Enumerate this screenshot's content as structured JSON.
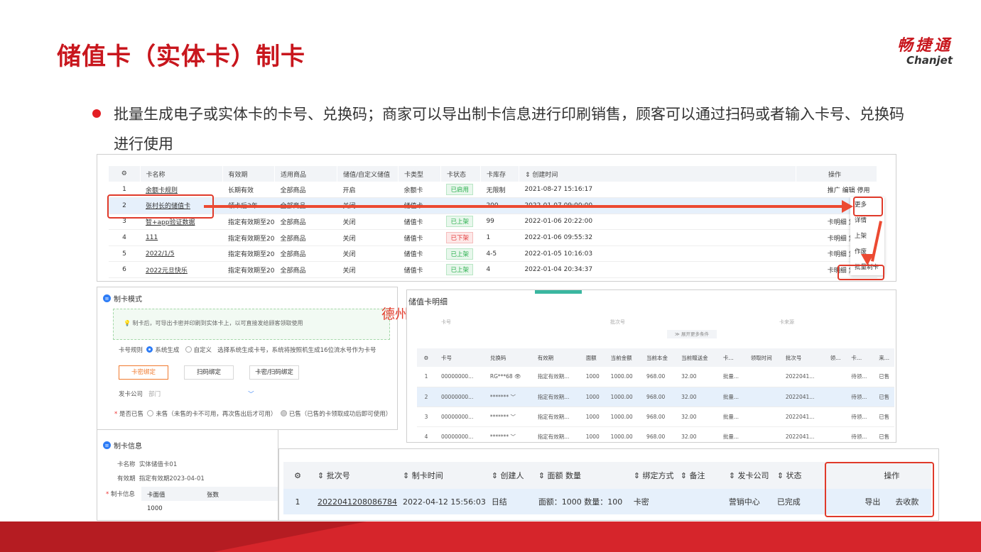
{
  "slide": {
    "title": "储值卡（实体卡）制卡",
    "brand_cn": "畅捷通",
    "brand_en": "Chanjet",
    "bullet": "批量生成电子或实体卡的卡号、兑换码；商家可以导出制卡信息进行印刷销售，顾客可以通过扫码或者输入卡号、兑换码进行使用",
    "watermark": "德州思亿"
  },
  "card_list": {
    "headers": [
      "卡名称",
      "有效期",
      "适用商品",
      "储值/自定义储值",
      "卡类型",
      "卡状态",
      "卡库存",
      "创建时间",
      "操作"
    ],
    "rows": [
      {
        "no": "1",
        "name": "余额卡规则",
        "validity": "长期有效",
        "goods": "全部商品",
        "custom": "开启",
        "type": "余额卡",
        "status": "已启用",
        "stock": "无限制",
        "created": "2021-08-27 15:16:17",
        "ops": "推广 编辑 停用"
      },
      {
        "no": "2",
        "name": "张村长的储值卡",
        "validity": "领卡后3年",
        "goods": "全部商品",
        "custom": "关闭",
        "type": "储值卡",
        "status": "",
        "stock": "200",
        "created": "2022-01-07 09:00:00",
        "ops": ""
      },
      {
        "no": "3",
        "name": "智+app验证数据",
        "validity": "指定有效期至20",
        "goods": "全部商品",
        "custom": "关闭",
        "type": "储值卡",
        "status": "已上架",
        "stock": "99",
        "created": "2022-01-06 20:22:00",
        "ops": "卡明细 复制 推"
      },
      {
        "no": "4",
        "name": "111",
        "validity": "指定有效期至20",
        "goods": "全部商品",
        "custom": "关闭",
        "type": "储值卡",
        "status": "已下架",
        "stock": "1",
        "created": "2022-01-06 09:55:32",
        "ops": "卡明细 复制 推"
      },
      {
        "no": "5",
        "name": "2022/1/5",
        "validity": "指定有效期至20",
        "goods": "全部商品",
        "custom": "关闭",
        "type": "储值卡",
        "status": "已上架",
        "stock": "4-5",
        "created": "2022-01-05 10:16:03",
        "ops": "卡明细 复制 推"
      },
      {
        "no": "6",
        "name": "2022元旦快乐",
        "validity": "指定有效期至20",
        "goods": "全部商品",
        "custom": "关闭",
        "type": "储值卡",
        "status": "已上架",
        "stock": "4",
        "created": "2022-01-04 20:34:37",
        "ops": "卡明细 复制 推"
      }
    ],
    "more_menu": [
      "更多",
      "详情",
      "上架",
      "作废",
      "批量制卡"
    ]
  },
  "make_mode": {
    "title": "制卡模式",
    "tip": "制卡后，可导出卡密并印刷到实体卡上，以可直接发给顾客领取使用",
    "rule_label": "卡号规则",
    "rule_opt1": "系统生成",
    "rule_opt2": "自定义",
    "rule_desc": "选择系统生成卡号，系统将按照机生成16位流水号作为卡号",
    "btn1": "卡密绑定",
    "btn2": "扫码绑定",
    "btn3": "卡密/扫码绑定",
    "company_label": "发卡公司",
    "company_placeholder": "部门",
    "collect_label": "是否已售",
    "collect_opt1": "未售（未售的卡不可用，再次售出后才可用）",
    "collect_opt2": "已售（已售的卡领取成功后即可使用）"
  },
  "make_info": {
    "title": "制卡信息",
    "name_label": "卡名称",
    "name_value": "实体储值卡01",
    "validity_label": "有效期",
    "validity_value": "指定有效期2023-04-01",
    "info_label": "制卡信息",
    "col1": "卡面值",
    "col2": "张数",
    "value1": "1000"
  },
  "card_detail": {
    "title": "储值卡明细",
    "filter1": "卡号",
    "filter2": "批次号",
    "filter3": "卡来源",
    "expand": "展开更多条件",
    "headers": [
      "卡号",
      "兑换码",
      "有效期",
      "面额",
      "当前金额",
      "当前本金",
      "当前赠送金",
      "卡…",
      "领取时间",
      "批次号",
      "领…",
      "卡…",
      "来…"
    ],
    "rows": [
      {
        "no": "1",
        "card": "00000000...",
        "code": "RG***68",
        "validity": "指定有效期...",
        "face": "1000",
        "cur": "1000.00",
        "principal": "968.00",
        "gift": "32.00",
        "kind": "批量...",
        "time": "",
        "batch": "2022041...",
        "c1": "",
        "c2": "待领...",
        "c3": "已售"
      },
      {
        "no": "2",
        "card": "00000000...",
        "code": "*******",
        "validity": "指定有效期...",
        "face": "1000",
        "cur": "1000.00",
        "principal": "968.00",
        "gift": "32.00",
        "kind": "批量...",
        "time": "",
        "batch": "2022041...",
        "c1": "",
        "c2": "待领...",
        "c3": "已售"
      },
      {
        "no": "3",
        "card": "00000000...",
        "code": "*******",
        "validity": "指定有效期...",
        "face": "1000",
        "cur": "1000.00",
        "principal": "968.00",
        "gift": "32.00",
        "kind": "批量...",
        "time": "",
        "batch": "2022041...",
        "c1": "",
        "c2": "待领...",
        "c3": "已售"
      },
      {
        "no": "4",
        "card": "00000000...",
        "code": "*******",
        "validity": "指定有效期...",
        "face": "1000",
        "cur": "1000.00",
        "principal": "968.00",
        "gift": "32.00",
        "kind": "批量...",
        "time": "",
        "batch": "2022041...",
        "c1": "",
        "c2": "待领...",
        "c3": "已售"
      }
    ]
  },
  "batch_list": {
    "headers": [
      "批次号",
      "制卡时间",
      "创建人",
      "面额 数量",
      "绑定方式",
      "备注",
      "发卡公司",
      "状态",
      "操作"
    ],
    "row": {
      "no": "1",
      "batch": "2022041208086784",
      "time": "2022-04-12 15:56:03",
      "creator": "日结",
      "amount": "面额：1000 数量：100",
      "bind": "卡密",
      "note": "",
      "company": "营销中心",
      "status": "已完成",
      "op1": "导出",
      "op2": "去收款"
    }
  },
  "colors": {
    "brand_red": "#c8161d",
    "highlight": "#e03a2a",
    "primary_blue": "#2d7cf6"
  }
}
